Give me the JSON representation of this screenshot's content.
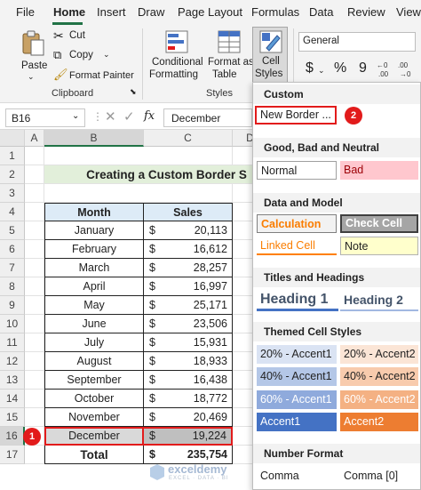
{
  "menu": {
    "tabs": [
      "File",
      "Home",
      "Insert",
      "Draw",
      "Page Layout",
      "Formulas",
      "Data",
      "Review",
      "View"
    ],
    "active_tab": "Home"
  },
  "ribbon": {
    "clipboard": {
      "paste": "Paste",
      "cut": "Cut",
      "copy": "Copy",
      "format_painter": "Format Painter",
      "group_label": "Clipboard"
    },
    "styles": {
      "conditional_formatting_1": "Conditional",
      "conditional_formatting_2": "Formatting",
      "format_as_table_1": "Format as",
      "format_as_table_2": "Table",
      "cell_styles_1": "Cell",
      "cell_styles_2": "Styles",
      "group_label": "Styles"
    },
    "number": {
      "format_value": "General",
      "currency": "$",
      "percent": "%",
      "comma": "9"
    }
  },
  "formula_bar": {
    "name_box": "B16",
    "fx": "fx",
    "content": "December"
  },
  "grid": {
    "columns": [
      "A",
      "B",
      "C",
      "D"
    ],
    "rows": [
      "1",
      "2",
      "3",
      "4",
      "5",
      "6",
      "7",
      "8",
      "9",
      "10",
      "11",
      "12",
      "13",
      "14",
      "15",
      "16",
      "17"
    ],
    "title": "Creating a Custom Border S",
    "header_month": "Month",
    "header_sales": "Sales",
    "currency_symbol": "$",
    "data": [
      {
        "month": "January",
        "sales": "20,113"
      },
      {
        "month": "February",
        "sales": "16,612"
      },
      {
        "month": "March",
        "sales": "28,257"
      },
      {
        "month": "April",
        "sales": "16,997"
      },
      {
        "month": "May",
        "sales": "25,171"
      },
      {
        "month": "June",
        "sales": "23,506"
      },
      {
        "month": "July",
        "sales": "15,931"
      },
      {
        "month": "August",
        "sales": "18,933"
      },
      {
        "month": "September",
        "sales": "16,438"
      },
      {
        "month": "October",
        "sales": "18,772"
      },
      {
        "month": "November",
        "sales": "20,469"
      },
      {
        "month": "December",
        "sales": "19,224"
      }
    ],
    "total_label": "Total",
    "total_value": "235,754"
  },
  "cell_styles_menu": {
    "custom_title": "Custom",
    "custom_item": "New Border ...",
    "good_bad_title": "Good, Bad and Neutral",
    "normal": "Normal",
    "bad": "Bad",
    "data_model_title": "Data and Model",
    "calculation": "Calculation",
    "check_cell": "Check Cell",
    "linked_cell": "Linked Cell",
    "note": "Note",
    "titles_title": "Titles and Headings",
    "heading1": "Heading 1",
    "heading2": "Heading 2",
    "themed_title": "Themed Cell Styles",
    "accent1_20": "20% - Accent1",
    "accent2_20": "20% - Accent2",
    "accent1_40": "40% - Accent1",
    "accent2_40": "40% - Accent2",
    "accent1_60": "60% - Accent1",
    "accent2_60": "60% - Accent2",
    "accent1": "Accent1",
    "accent2": "Accent2",
    "number_format_title": "Number Format",
    "comma": "Comma",
    "comma0": "Comma [0]"
  },
  "annotations": {
    "step1": "1",
    "step2": "2"
  },
  "watermark": {
    "brand": "exceldemy",
    "tagline": "EXCEL · DATA · BI"
  },
  "colors": {
    "excel_green": "#217346",
    "title_fill": "#e2efda",
    "header_fill": "#ddebf7",
    "highlight_red": "#e21b1b",
    "bad_fill": "#ffc7ce",
    "bad_text": "#9c0006",
    "calc_fill": "#f2f2f2",
    "calc_text": "#fa7d00",
    "check_fill": "#a5a5a5",
    "note_fill": "#ffffcc",
    "heading_color": "#44546a",
    "accent1": "#4472c4",
    "accent2": "#ed7d31"
  }
}
